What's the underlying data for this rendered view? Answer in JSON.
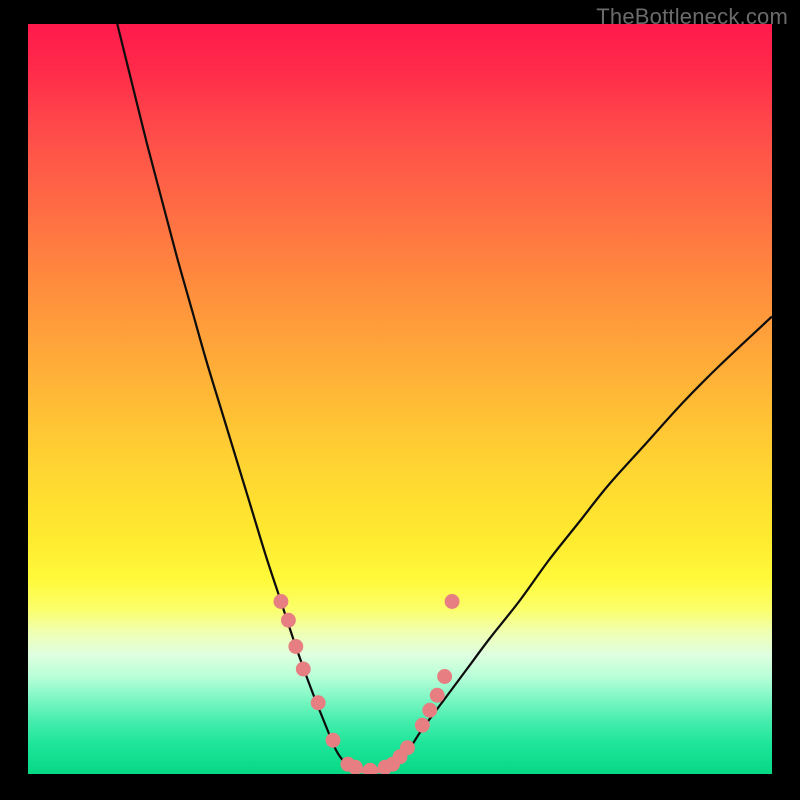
{
  "watermark": "TheBottleneck.com",
  "chart_data": {
    "type": "line",
    "title": "",
    "xlabel": "",
    "ylabel": "",
    "xlim": [
      0,
      100
    ],
    "ylim": [
      0,
      100
    ],
    "series": [
      {
        "name": "left-curve",
        "x": [
          12,
          14,
          16,
          18,
          20,
          22,
          24,
          26,
          28,
          30,
          32,
          34,
          36,
          38,
          40,
          41.5,
          43
        ],
        "y": [
          100,
          92,
          84,
          76.5,
          69,
          62,
          55,
          48.5,
          42,
          35.5,
          29,
          23,
          17,
          11.5,
          6.5,
          3,
          1
        ]
      },
      {
        "name": "right-curve",
        "x": [
          49,
          51,
          53,
          56,
          59,
          62,
          66,
          70,
          74,
          78,
          83,
          88,
          93,
          100
        ],
        "y": [
          1,
          3,
          6,
          10,
          14,
          18,
          23,
          28.5,
          33.5,
          38.5,
          44,
          49.5,
          54.5,
          61
        ]
      },
      {
        "name": "valley-flat",
        "x": [
          43,
          44,
          45,
          46,
          47,
          48,
          49
        ],
        "y": [
          1,
          0.6,
          0.5,
          0.5,
          0.5,
          0.6,
          1
        ]
      }
    ],
    "markers": {
      "name": "highlight-dots",
      "color": "#e77f82",
      "x": [
        34,
        35,
        36,
        37,
        39,
        41,
        43,
        44,
        46,
        48,
        49,
        50,
        51,
        53,
        54,
        55,
        56,
        57
      ],
      "y": [
        23,
        20.5,
        17,
        14,
        9.5,
        4.5,
        1.3,
        0.9,
        0.5,
        0.9,
        1.3,
        2.3,
        3.5,
        6.5,
        8.5,
        10.5,
        13,
        23
      ]
    },
    "colors": {
      "curve": "#0d0d0d",
      "marker": "#e77f82"
    }
  }
}
